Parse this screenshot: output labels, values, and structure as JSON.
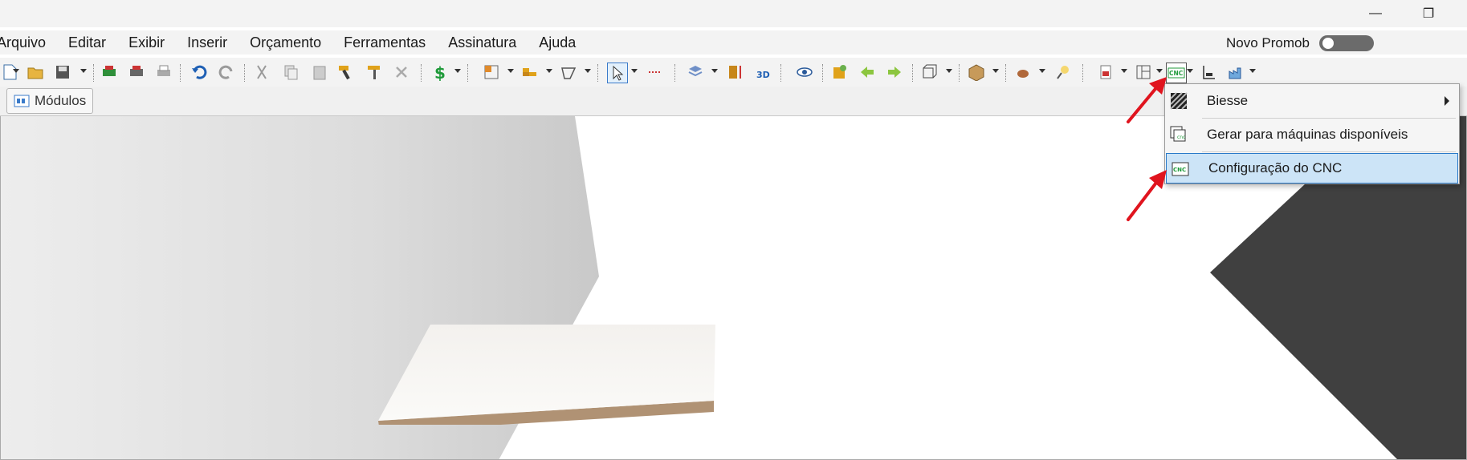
{
  "menu": {
    "items": [
      "Arquivo",
      "Editar",
      "Exibir",
      "Inserir",
      "Orçamento",
      "Ferramentas",
      "Assinatura",
      "Ajuda"
    ]
  },
  "promob_toggle": {
    "label": "Novo Promob",
    "state": "off"
  },
  "window_controls": {
    "minimize": "—",
    "restore": "❐"
  },
  "tabs": [
    {
      "label": "Módulos"
    }
  ],
  "cnc_button": {
    "label": "CNC",
    "color": "#1f9a3a"
  },
  "dropdown": {
    "items": [
      {
        "label": "Biesse",
        "has_submenu": true,
        "icon": "striped-icon",
        "selected": false
      },
      {
        "label": "Gerar para máquinas disponíveis",
        "has_submenu": false,
        "icon": "machines-icon",
        "selected": false
      },
      {
        "label": "Configuração do CNC",
        "has_submenu": false,
        "icon": "cnc-config-icon",
        "selected": true
      }
    ]
  },
  "colors": {
    "annotation_arrow": "#e0141e",
    "selection": "#cce4f7",
    "wall_dark": "#404040"
  }
}
